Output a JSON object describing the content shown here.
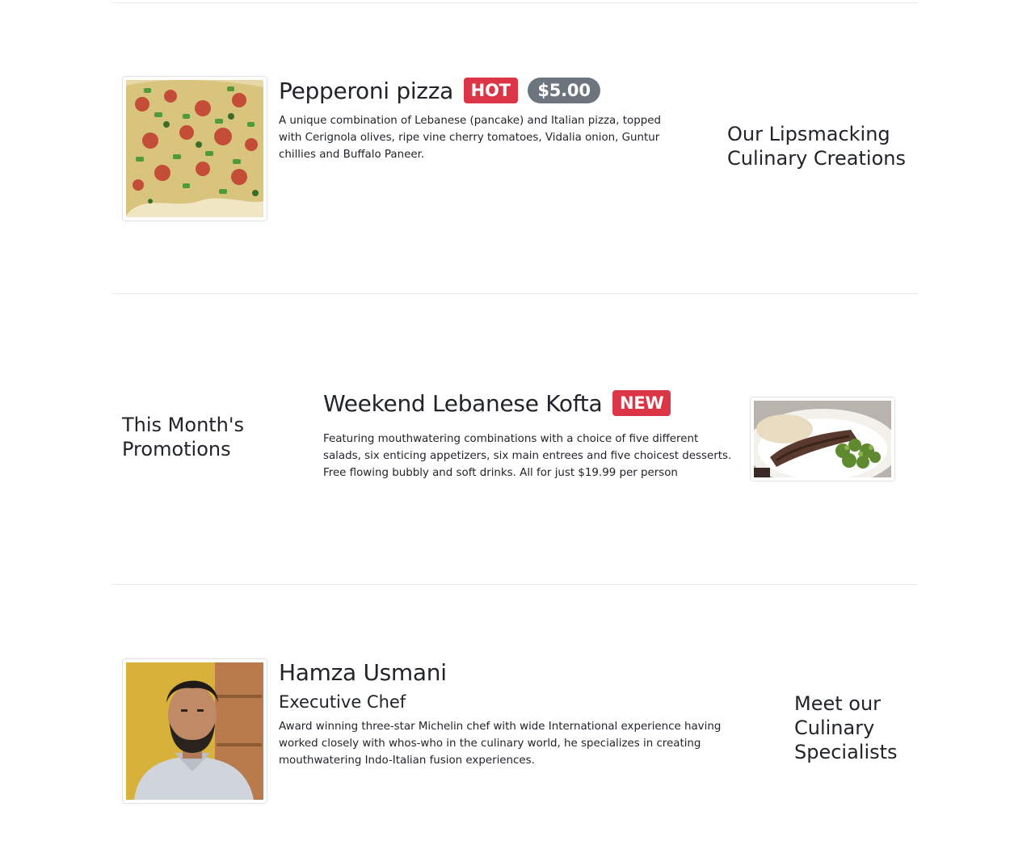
{
  "dishes": [
    {
      "name": "Pepperoni pizza",
      "badges": [
        "HOT",
        "$5.00"
      ],
      "description": "A unique combination of Lebanese (pancake) and Italian pizza, topped with Cerignola olives, ripe vine cherry tomatoes, Vidalia onion, Guntur chillies and Buffalo Paneer.",
      "side_heading": "Our Lipsmacking Culinary Creations",
      "badge_colors": {
        "hot": "#dc3545",
        "price": "#6c757d"
      }
    },
    {
      "name": "Weekend Lebanese Kofta",
      "badges": [
        "NEW"
      ],
      "description": "Featuring mouthwatering combinations with a choice of five different salads, six enticing appetizers, six main entrees and five choicest desserts. Free flowing bubbly and soft drinks. All for just $19.99 per person",
      "side_heading": "This Month's Promotions"
    }
  ],
  "leader": {
    "name": "Hamza Usmani",
    "designation": "Executive Chef",
    "description": "Award winning three-star Michelin chef with wide International experience having worked closely with whos-who in the culinary world, he specializes in creating mouthwatering Indo-Italian fusion experiences.",
    "side_heading": "Meet our Culinary Specialists"
  }
}
